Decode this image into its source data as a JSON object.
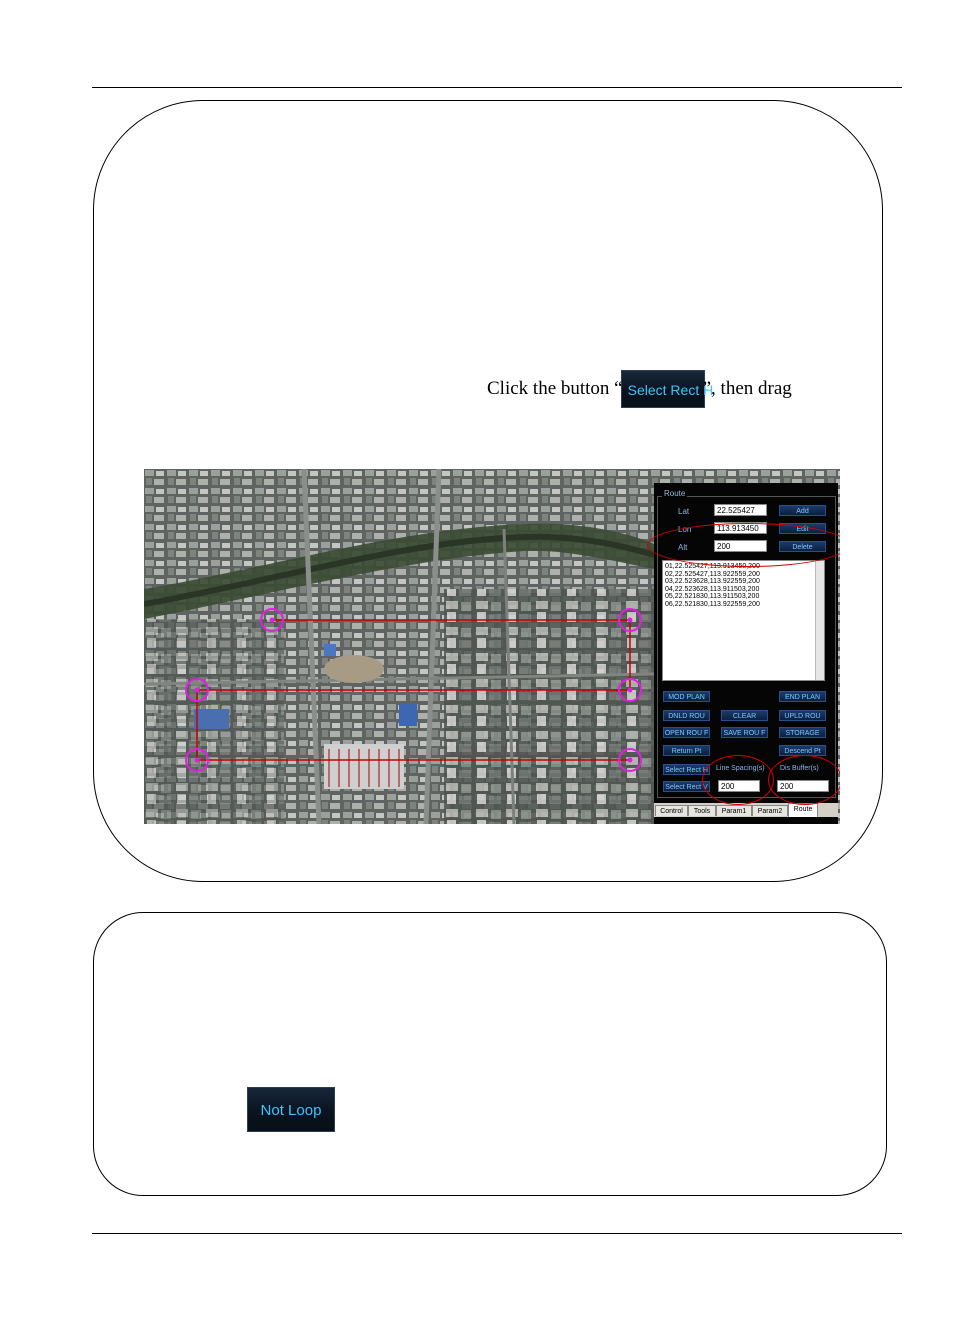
{
  "instruction": {
    "before": "Click the button “",
    "button_label": "Select Rect H",
    "after": "”, then drag"
  },
  "route_panel": {
    "group_title": "Route",
    "lat_label": "Lat",
    "lat_value": "22.525427",
    "lon_label": "Lon",
    "lon_value": "113.913450",
    "alt_label": "Alt",
    "alt_value": "200",
    "add_button": "Add",
    "edit_button": "Edit",
    "delete_button": "Delete",
    "waypoints": [
      "01,22.525427,113.913450,200",
      "02,22.525427,113.922559,200",
      "03,22.523628,113.922559,200",
      "04,22.523628,113.911503,200",
      "05,22.521830,113.911503,200",
      "06,22.521830,113.922559,200"
    ],
    "buttons": {
      "mod_plan": "MOD PLAN",
      "end_plan": "END PLAN",
      "dnld_rou": "DNLD ROU",
      "clear": "CLEAR",
      "upld_rou": "UPLD ROU",
      "open_rou_f": "OPEN ROU F",
      "save_rou_f": "SAVE ROU F",
      "storage": "STORAGE",
      "return_pt": "Return Pt",
      "descend_pt": "Descend Pt",
      "select_rect_h": "Select Rect H",
      "select_rect_v": "Select Rect V"
    },
    "line_spacing_label": "Line Spacing(s)",
    "line_spacing_value": "200",
    "dis_buffer_label": "Dis Buffer(s)",
    "dis_buffer_value": "200",
    "tabs": [
      "Control",
      "Tools",
      "Param1",
      "Param2",
      "Route"
    ],
    "active_tab": "Route"
  },
  "not_loop_button": "Not Loop",
  "colors": {
    "button_text": "#3ec3ff",
    "route_line": "#c80000",
    "waypoint_marker": "#e020e0",
    "highlight_ellipse": "#d40000"
  }
}
